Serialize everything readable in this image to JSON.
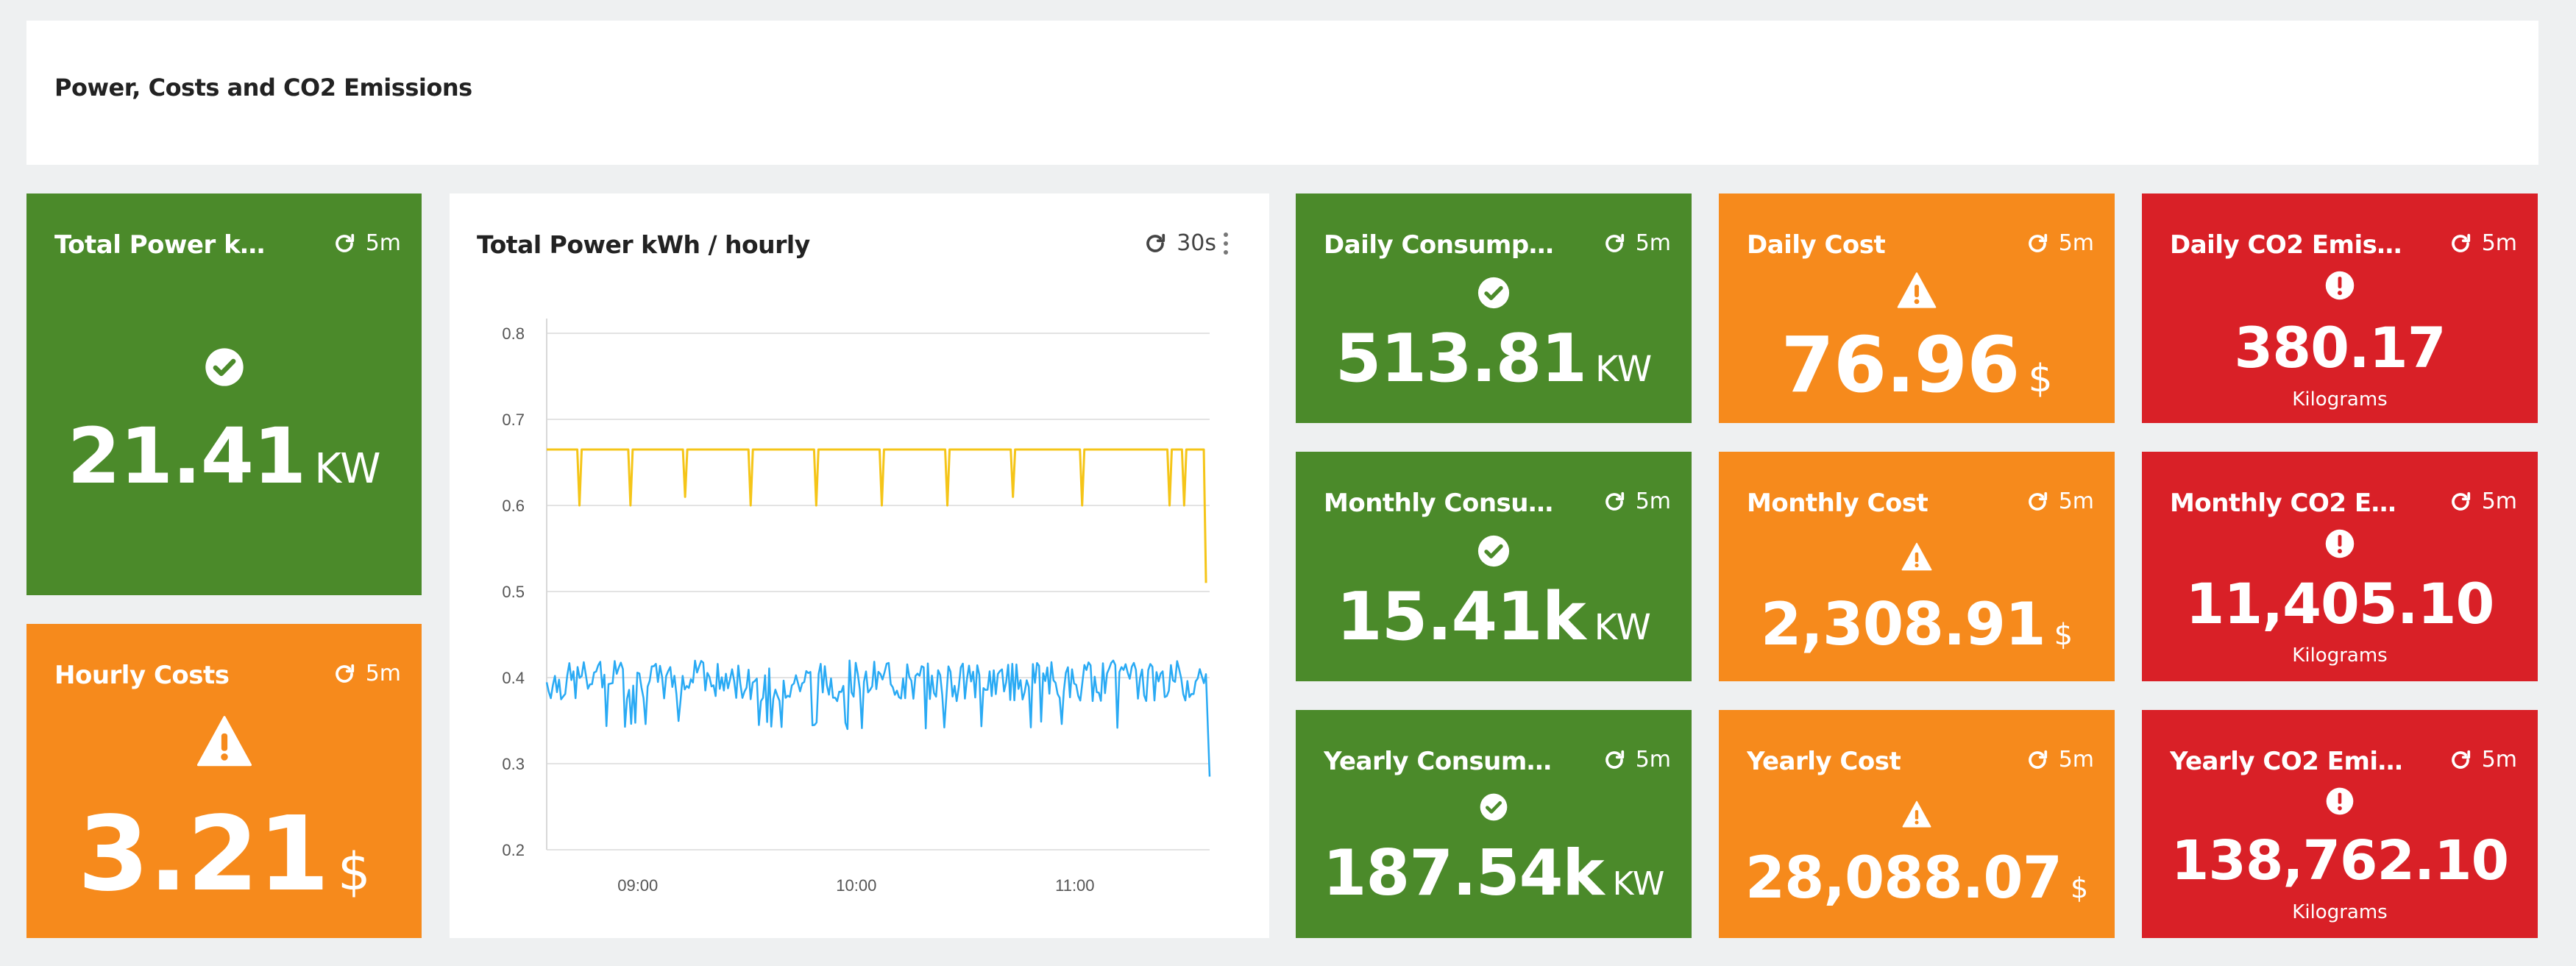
{
  "header": {
    "title": "Power, Costs and CO2 Emissions"
  },
  "colors": {
    "green": "#4b8a2a",
    "orange": "#f68a1c",
    "red": "#d92027",
    "series_yellow": "#f5c518",
    "series_blue": "#29aaf4"
  },
  "tiles": {
    "total_power": {
      "title": "Total Power kWh / h...",
      "refresh": "5m",
      "icon": "check-circle-icon",
      "value": "21.41",
      "unit": "KW"
    },
    "hourly_costs": {
      "title": "Hourly Costs",
      "refresh": "5m",
      "icon": "warning-triangle-icon",
      "value": "3.21",
      "unit": "$"
    },
    "daily_consumption": {
      "title": "Daily Consumption ...",
      "refresh": "5m",
      "icon": "check-circle-icon",
      "value": "513.81",
      "unit": "KW"
    },
    "monthly_consumption": {
      "title": "Monthly Consumpti...",
      "refresh": "5m",
      "icon": "check-circle-icon",
      "value": "15.41k",
      "unit": "KW"
    },
    "yearly_consumption": {
      "title": "Yearly Consumption...",
      "refresh": "5m",
      "icon": "check-circle-icon",
      "value": "187.54k",
      "unit": "KW"
    },
    "daily_cost": {
      "title": "Daily Cost",
      "refresh": "5m",
      "icon": "warning-triangle-icon",
      "value": "76.96",
      "unit": "$"
    },
    "monthly_cost": {
      "title": "Monthly Cost",
      "refresh": "5m",
      "icon": "warning-triangle-icon",
      "value": "2,308.91",
      "unit": "$"
    },
    "yearly_cost": {
      "title": "Yearly Cost",
      "refresh": "5m",
      "icon": "warning-triangle-icon",
      "value": "28,088.07",
      "unit": "$"
    },
    "daily_co2": {
      "title": "Daily CO2 Emissions",
      "refresh": "5m",
      "icon": "exclamation-circle-icon",
      "value": "380.17",
      "sub": "Kilograms"
    },
    "monthly_co2": {
      "title": "Monthly CO2 Emissi...",
      "refresh": "5m",
      "icon": "exclamation-circle-icon",
      "value": "11,405.10",
      "sub": "Kilograms"
    },
    "yearly_co2": {
      "title": "Yearly CO2 Emissions",
      "refresh": "5m",
      "icon": "exclamation-circle-icon",
      "value": "138,762.10",
      "sub": "Kilograms"
    }
  },
  "chart_panel": {
    "title": "Total Power kWh / hourly",
    "refresh": "30s"
  },
  "chart_data": {
    "type": "line",
    "title": "Total Power kWh / hourly",
    "xlabel": "",
    "ylabel": "",
    "ylim": [
      0.2,
      0.8
    ],
    "y_ticks": [
      "0.8",
      "0.7",
      "0.6",
      "0.5",
      "0.4",
      "0.3",
      "0.2"
    ],
    "x_ticks": [
      "09:00",
      "10:00",
      "11:00"
    ],
    "x_range": [
      "08:35",
      "11:37"
    ],
    "grid": true,
    "legend": "none",
    "series": [
      {
        "color": "#f5c518",
        "baseline": 0.665,
        "dips": [
          {
            "time": "08:44",
            "value": 0.6
          },
          {
            "time": "08:58",
            "value": 0.6
          },
          {
            "time": "09:13",
            "value": 0.61
          },
          {
            "time": "09:31",
            "value": 0.6
          },
          {
            "time": "09:49",
            "value": 0.6
          },
          {
            "time": "10:07",
            "value": 0.6
          },
          {
            "time": "10:25",
            "value": 0.6
          },
          {
            "time": "10:43",
            "value": 0.61
          },
          {
            "time": "11:02",
            "value": 0.6
          },
          {
            "time": "11:26",
            "value": 0.6
          },
          {
            "time": "11:30",
            "value": 0.6
          },
          {
            "time": "11:36",
            "value": 0.51
          }
        ]
      },
      {
        "color": "#29aaf4",
        "baseline": 0.395,
        "range": [
          0.34,
          0.42
        ],
        "end_value": 0.285
      }
    ]
  }
}
